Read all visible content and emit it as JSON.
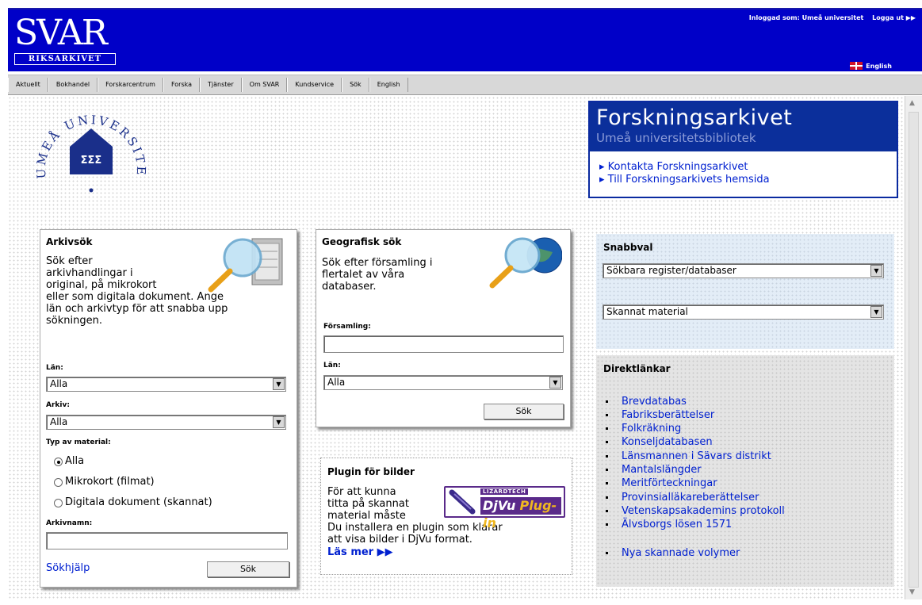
{
  "header": {
    "logo_main": "SVAR",
    "logo_sub": "RIKSARKIVET",
    "top_links": [
      "Inloggad som: Umeå universitet",
      "Logga ut ▶▶"
    ],
    "english": "English"
  },
  "nav": [
    "Aktuellt",
    "Bokhandel",
    "Forskarcentrum",
    "Forska",
    "Tjänster",
    "Om SVAR",
    "Kundservice",
    "Sök",
    "English"
  ],
  "university_logo": {
    "text": "UMEÅ UNIVERSITET",
    "emblem": "ΣΣΣ"
  },
  "forskningsarkivet": {
    "title": "Forskningsarkivet",
    "subtitle": "Umeå universitetsbibliotek",
    "links": [
      "Kontakta Forskningsarkivet",
      "Till Forskningsarkivets hemsida"
    ]
  },
  "arkivsok": {
    "title": "Arkivsök",
    "description_lines": [
      "Sök efter",
      "arkivhandlingar i",
      "original, på mikrokort",
      "eller som digitala dokument. Ange",
      "län och arkivtyp för att snabba upp",
      "sökningen."
    ],
    "lan_label": "Län:",
    "lan_value": "Alla",
    "arkiv_label": "Arkiv:",
    "arkiv_value": "Alla",
    "typ_label": "Typ av material:",
    "typ_options": [
      "Alla",
      "Mikrokort (filmat)",
      "Digitala dokument (skannat)"
    ],
    "typ_selected": 0,
    "arkivnamn_label": "Arkivnamn:",
    "arkivnamn_value": "",
    "help_link": "Sökhjälp",
    "search_button": "Sök"
  },
  "geografisk": {
    "title": "Geografisk sök",
    "description_lines": [
      "Sök efter församling i",
      "flertalet av våra",
      "databaser."
    ],
    "forsamling_label": "Församling:",
    "forsamling_value": "",
    "lan_label": "Län:",
    "lan_value": "Alla",
    "search_button": "Sök"
  },
  "plugin": {
    "title": "Plugin för bilder",
    "lines": [
      "För att kunna",
      "titta på skannat",
      "material måste",
      "Du installera en plugin som klarar",
      "att visa bilder i DjVu format."
    ],
    "read_more": "Läs mer ▶▶",
    "logo_brand": "LIZARDTECH",
    "logo_text_a": "DjVu",
    "logo_text_b": "Plug-in"
  },
  "snabbval": {
    "title": "Snabbval",
    "select1": "Sökbara register/databaser",
    "select2": "Skannat material"
  },
  "direktlankar": {
    "title": "Direktlänkar",
    "links": [
      "Brevdatabas",
      "Fabriksberättelser",
      "Folkräkning",
      "Konseljdatabasen",
      "Länsmannen i Sävars distrikt",
      "Mantalslängder",
      "Meritförteckningar",
      "Provinsialläkareberättelser",
      "Vetenskapsakademins protokoll",
      "Älvsborgs lösen 1571"
    ],
    "extra_link": "Nya skannade volymer"
  },
  "colors": {
    "header_blue": "#0000c8",
    "link_blue": "#0020d0",
    "fa_blue": "#0b2f9b"
  }
}
